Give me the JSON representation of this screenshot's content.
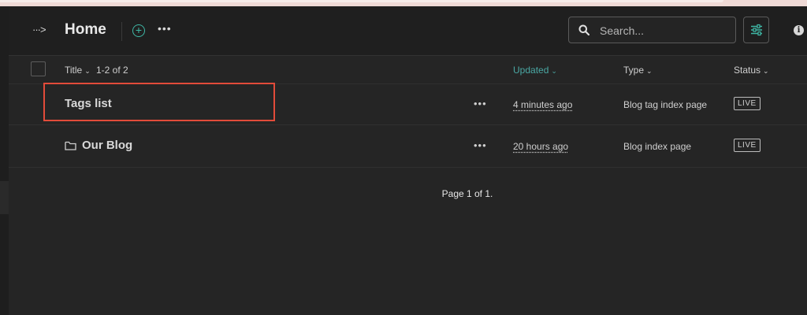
{
  "header": {
    "collapse_label": "···>",
    "title": "Home",
    "add_label": "+",
    "more_label": "•••",
    "search_placeholder": "Search...",
    "info_label": "i"
  },
  "table": {
    "columns": {
      "title": "Title",
      "count": "1-2 of 2",
      "updated": "Updated",
      "type": "Type",
      "status": "Status"
    },
    "rows": [
      {
        "title": "Tags list",
        "updated": "4 minutes ago",
        "type": "Blog tag index page",
        "status": "LIVE",
        "icon": "none"
      },
      {
        "title": "Our Blog",
        "updated": "20 hours ago",
        "type": "Blog index page",
        "status": "LIVE",
        "icon": "folder-icon"
      }
    ],
    "row_actions_label": "•••",
    "sort_chevron": "⌄"
  },
  "pagination": {
    "text": "Page 1 of 1."
  },
  "colors": {
    "accent": "#3fb8a6",
    "highlight": "#e24b3a",
    "background": "#252525"
  }
}
